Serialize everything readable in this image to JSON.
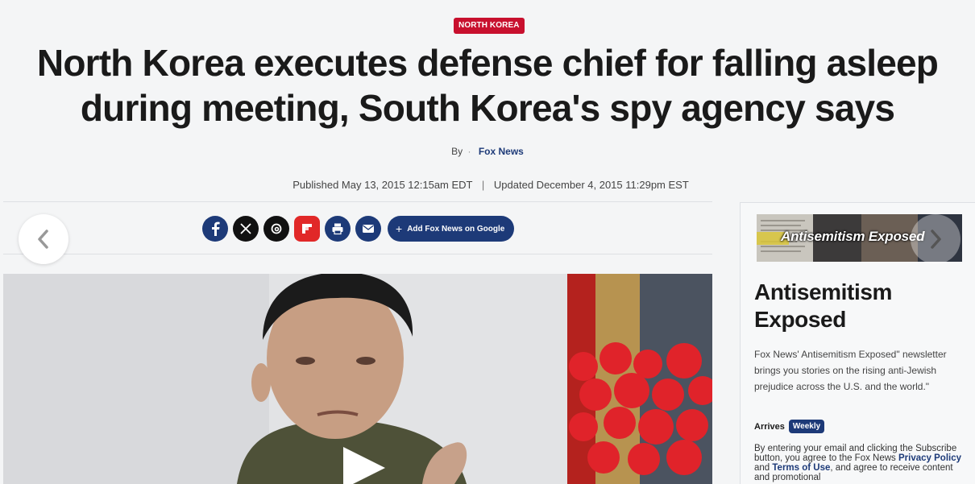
{
  "article": {
    "category": "NORTH KOREA",
    "headline": "North Korea executes defense chief for falling asleep during meeting, South Korea's spy agency says",
    "by_label": "By",
    "byline_sep": "·",
    "author": "Fox News",
    "published": "Published May 13, 2015 12:15am EDT",
    "date_sep": "|",
    "updated": "Updated December 4, 2015 11:29pm EST"
  },
  "share": {
    "icons": [
      "facebook-icon",
      "x-icon",
      "threads-icon",
      "flipboard-icon",
      "print-icon",
      "email-icon"
    ],
    "google_plus": "+",
    "google_label": "Add Fox News on Google"
  },
  "newsletter": {
    "banner_text": "Antisemitism Exposed",
    "title": "Antisemitism Exposed",
    "description": "Fox News' Antisemitism Exposed\" newsletter brings you stories on the rising anti-Jewish prejudice across the U.S. and the world.\"",
    "arrives_label": "Arrives",
    "frequency": "Weekly",
    "legal_prefix": "By entering your email and clicking the Subscribe button, you agree to the Fox News",
    "privacy_link": "Privacy Policy",
    "legal_and": "and",
    "terms_link": "Terms of Use",
    "legal_suffix": ", and agree to receive content and promotional"
  },
  "colors": {
    "brand_navy": "#1d3a78",
    "category_red": "#c8102e"
  }
}
